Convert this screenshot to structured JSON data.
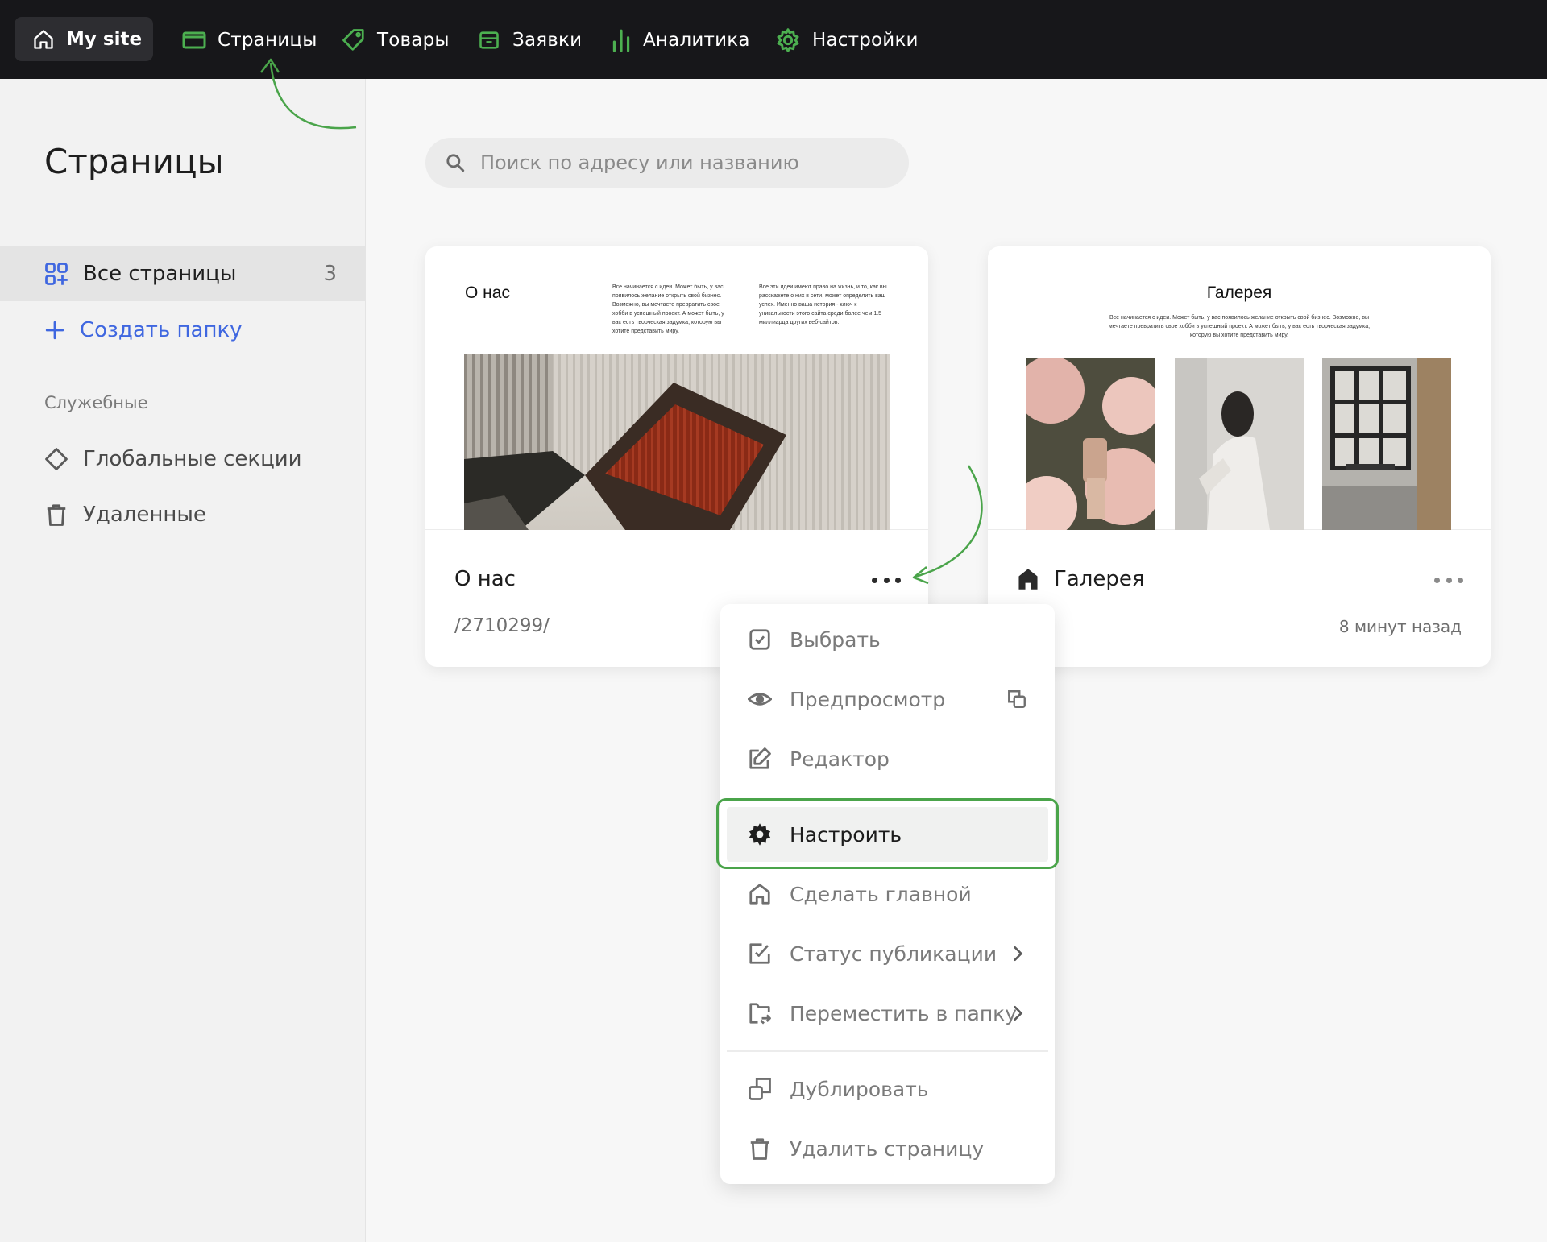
{
  "topnav": {
    "site": "My site",
    "items": [
      {
        "label": "Страницы",
        "icon": "pages-icon"
      },
      {
        "label": "Товары",
        "icon": "tag-icon"
      },
      {
        "label": "Заявки",
        "icon": "inbox-icon"
      },
      {
        "label": "Аналитика",
        "icon": "bar-chart-icon"
      },
      {
        "label": "Настройки",
        "icon": "gear-icon"
      }
    ],
    "accent": "#4caf50"
  },
  "sidebar": {
    "title": "Страницы",
    "all_pages": {
      "label": "Все страницы",
      "count": "3"
    },
    "create_folder": "Создать папку",
    "section_caption": "Служебные",
    "global_sections": "Глобальные секции",
    "deleted": "Удаленные"
  },
  "search": {
    "placeholder": "Поиск по адресу или названию"
  },
  "cards": [
    {
      "title": "О нас",
      "subtitle": "/2710299/",
      "preview": {
        "heading": "О нас",
        "col1": "Все начинается с идеи. Может быть, у вас появилось желание открыть свой бизнес. Возможно, вы мечтаете превратить свое хобби в успешный проект. А может быть, у вас есть творческая задумка, которую вы хотите представить миру.",
        "col2": "Все эти идеи имеют право на жизнь, и то, как вы расскажете о них в сети, может определить ваш успех. Именно ваша история - ключ к уникальности этого сайта среди более чем 1.5 миллиарда других веб-сайтов."
      }
    },
    {
      "title": "Галерея",
      "time": "8 минут назад",
      "preview": {
        "heading": "Галерея",
        "text": "Все начинается с идеи. Может быть, у вас появилось желание открыть свой бизнес. Возможно, вы мечтаете превратить свое хобби в успешный проект. А может быть, у вас есть творческая задумка, которую вы хотите представить миру."
      }
    }
  ],
  "menu": {
    "select": "Выбрать",
    "preview": "Предпросмотр",
    "editor": "Редактор",
    "configure": "Настроить",
    "make_home": "Сделать главной",
    "publish_status": "Статус публикации",
    "move_to_folder": "Переместить в папку",
    "duplicate": "Дублировать",
    "delete": "Удалить страницу"
  }
}
